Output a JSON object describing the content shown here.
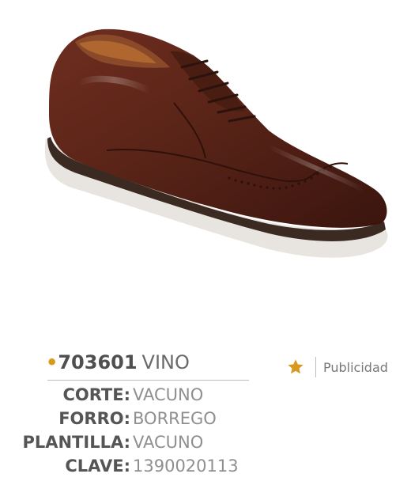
{
  "product": {
    "bullet": "•",
    "code": "703601",
    "color": "VINO",
    "specs": [
      {
        "label": "CORTE:",
        "value": "VACUNO"
      },
      {
        "label": "FORRO:",
        "value": "BORREGO"
      },
      {
        "label": "PLANTILLA:",
        "value": "VACUNO"
      },
      {
        "label": "CLAVE:",
        "value": "1390020113"
      }
    ]
  },
  "ad": {
    "icon": "star-icon",
    "label": "Publicidad"
  },
  "colors": {
    "accent": "#d79a1e",
    "shoe_leather": "#5a2418",
    "sole": "#e8e4df"
  }
}
